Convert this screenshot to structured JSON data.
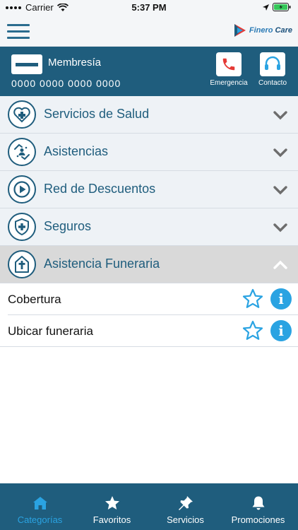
{
  "status_bar": {
    "carrier": "Carrier",
    "time": "5:37 PM"
  },
  "header": {
    "logo_name": "Finero",
    "logo_suffix": "Care"
  },
  "membership": {
    "title": "Membresía",
    "number": "0000 0000 0000 0000",
    "emergency_label": "Emergencia",
    "contact_label": "Contacto"
  },
  "categories": [
    {
      "label": "Servicios de Salud",
      "icon": "heart-plus-icon",
      "expanded": false
    },
    {
      "label": "Asistencias",
      "icon": "hands-assist-icon",
      "expanded": false
    },
    {
      "label": "Red de Descuentos",
      "icon": "play-circle-icon",
      "expanded": false
    },
    {
      "label": "Seguros",
      "icon": "shield-plus-icon",
      "expanded": false
    },
    {
      "label": "Asistencia Funeraria",
      "icon": "chapel-cross-icon",
      "expanded": true,
      "items": [
        {
          "label": "Cobertura"
        },
        {
          "label": "Ubicar funeraria"
        }
      ]
    }
  ],
  "tabs": [
    {
      "label": "Categorías",
      "icon": "home-icon",
      "active": true
    },
    {
      "label": "Favoritos",
      "icon": "star-icon",
      "active": false
    },
    {
      "label": "Servicios",
      "icon": "pin-icon",
      "active": false
    },
    {
      "label": "Promociones",
      "icon": "bell-icon",
      "active": false
    }
  ],
  "colors": {
    "primary": "#1f5d7d",
    "accent": "#2aa3e2",
    "emergency": "#e53935",
    "list_bg": "#eef2f6",
    "expanded_bg": "#d9d9d9"
  }
}
